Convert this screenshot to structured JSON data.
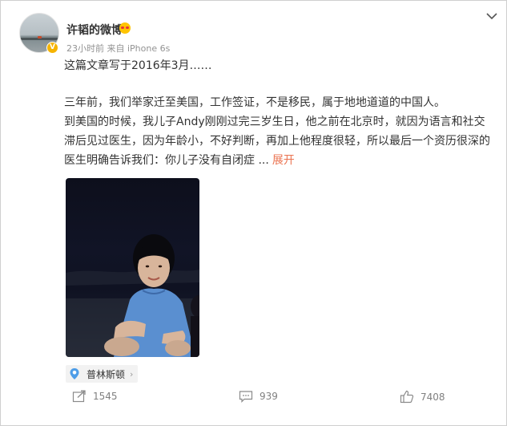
{
  "post": {
    "author": "许韬的微博",
    "meta": "23小时前  来自 iPhone 6s",
    "paragraphs": [
      "这篇文章写于2016年3月……",
      "三年前，我们举家迁至美国，工作签证，不是移民，属于地地道道的中国人。",
      "到美国的时候，我儿子Andy刚刚过完三岁生日，他之前在北京时，就因为语言和社交滞后见过医生，因为年龄小，不好判断，再加上他程度很轻，所以最后一个资历很深的医生明确告诉我们：你儿子没有自闭症 ..."
    ],
    "expand_label": "展开",
    "location": "普林斯顿",
    "location_suffix": "›"
  },
  "actions": {
    "share_count": "1545",
    "comment_count": "939",
    "like_count": "7408"
  },
  "colors": {
    "accent": "#eb7350",
    "badge": "#f6b400",
    "muted": "#939393"
  },
  "icons": {
    "share": "share-icon",
    "comment": "comment-icon",
    "like": "thumbs-up-icon",
    "location": "location-pin-icon",
    "menu": "chevron-down-icon"
  }
}
